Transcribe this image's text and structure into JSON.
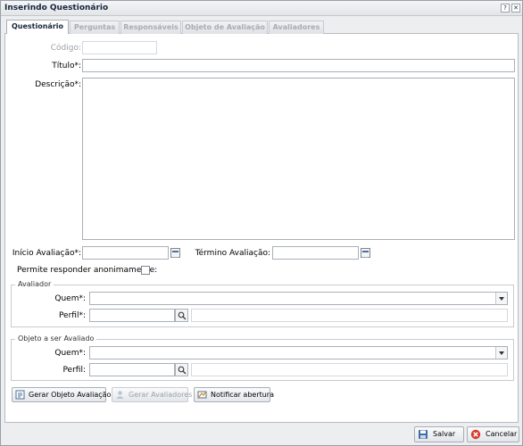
{
  "window": {
    "title": "Inserindo Questionário",
    "help_glyph": "?",
    "close_glyph": "✕"
  },
  "tabs": [
    {
      "label": "Questionário",
      "active": true
    },
    {
      "label": "Perguntas",
      "active": false
    },
    {
      "label": "Responsáveis",
      "active": false
    },
    {
      "label": "Objeto de Avaliação",
      "active": false
    },
    {
      "label": "Avaliadores",
      "active": false
    }
  ],
  "form": {
    "codigo_label": "Código:",
    "codigo_value": "",
    "titulo_label": "Título*:",
    "titulo_value": "",
    "descricao_label": "Descrição*:",
    "descricao_value": "",
    "inicio_label": "Início Avaliação*:",
    "inicio_value": "",
    "termino_label": "Término Avaliação:",
    "termino_value": "",
    "anonimo_label": "Permite responder anonimamente:",
    "anonimo_checked": false
  },
  "avaliador": {
    "legend": "Avaliador",
    "quem_label": "Quem*:",
    "quem_value": "",
    "perfil_label": "Perfil*:",
    "perfil_value": "",
    "perfil_desc": ""
  },
  "objeto": {
    "legend": "Objeto a ser Avaliado",
    "quem_label": "Quem*:",
    "quem_value": "",
    "perfil_label": "Perfil:",
    "perfil_value": "",
    "perfil_desc": ""
  },
  "actions": {
    "gerar_objeto": "Gerar Objeto Avaliação",
    "gerar_avaliadores": "Gerar Avaliadores",
    "notificar": "Notificar abertura"
  },
  "footer": {
    "salvar": "Salvar",
    "cancelar": "Cancelar"
  }
}
